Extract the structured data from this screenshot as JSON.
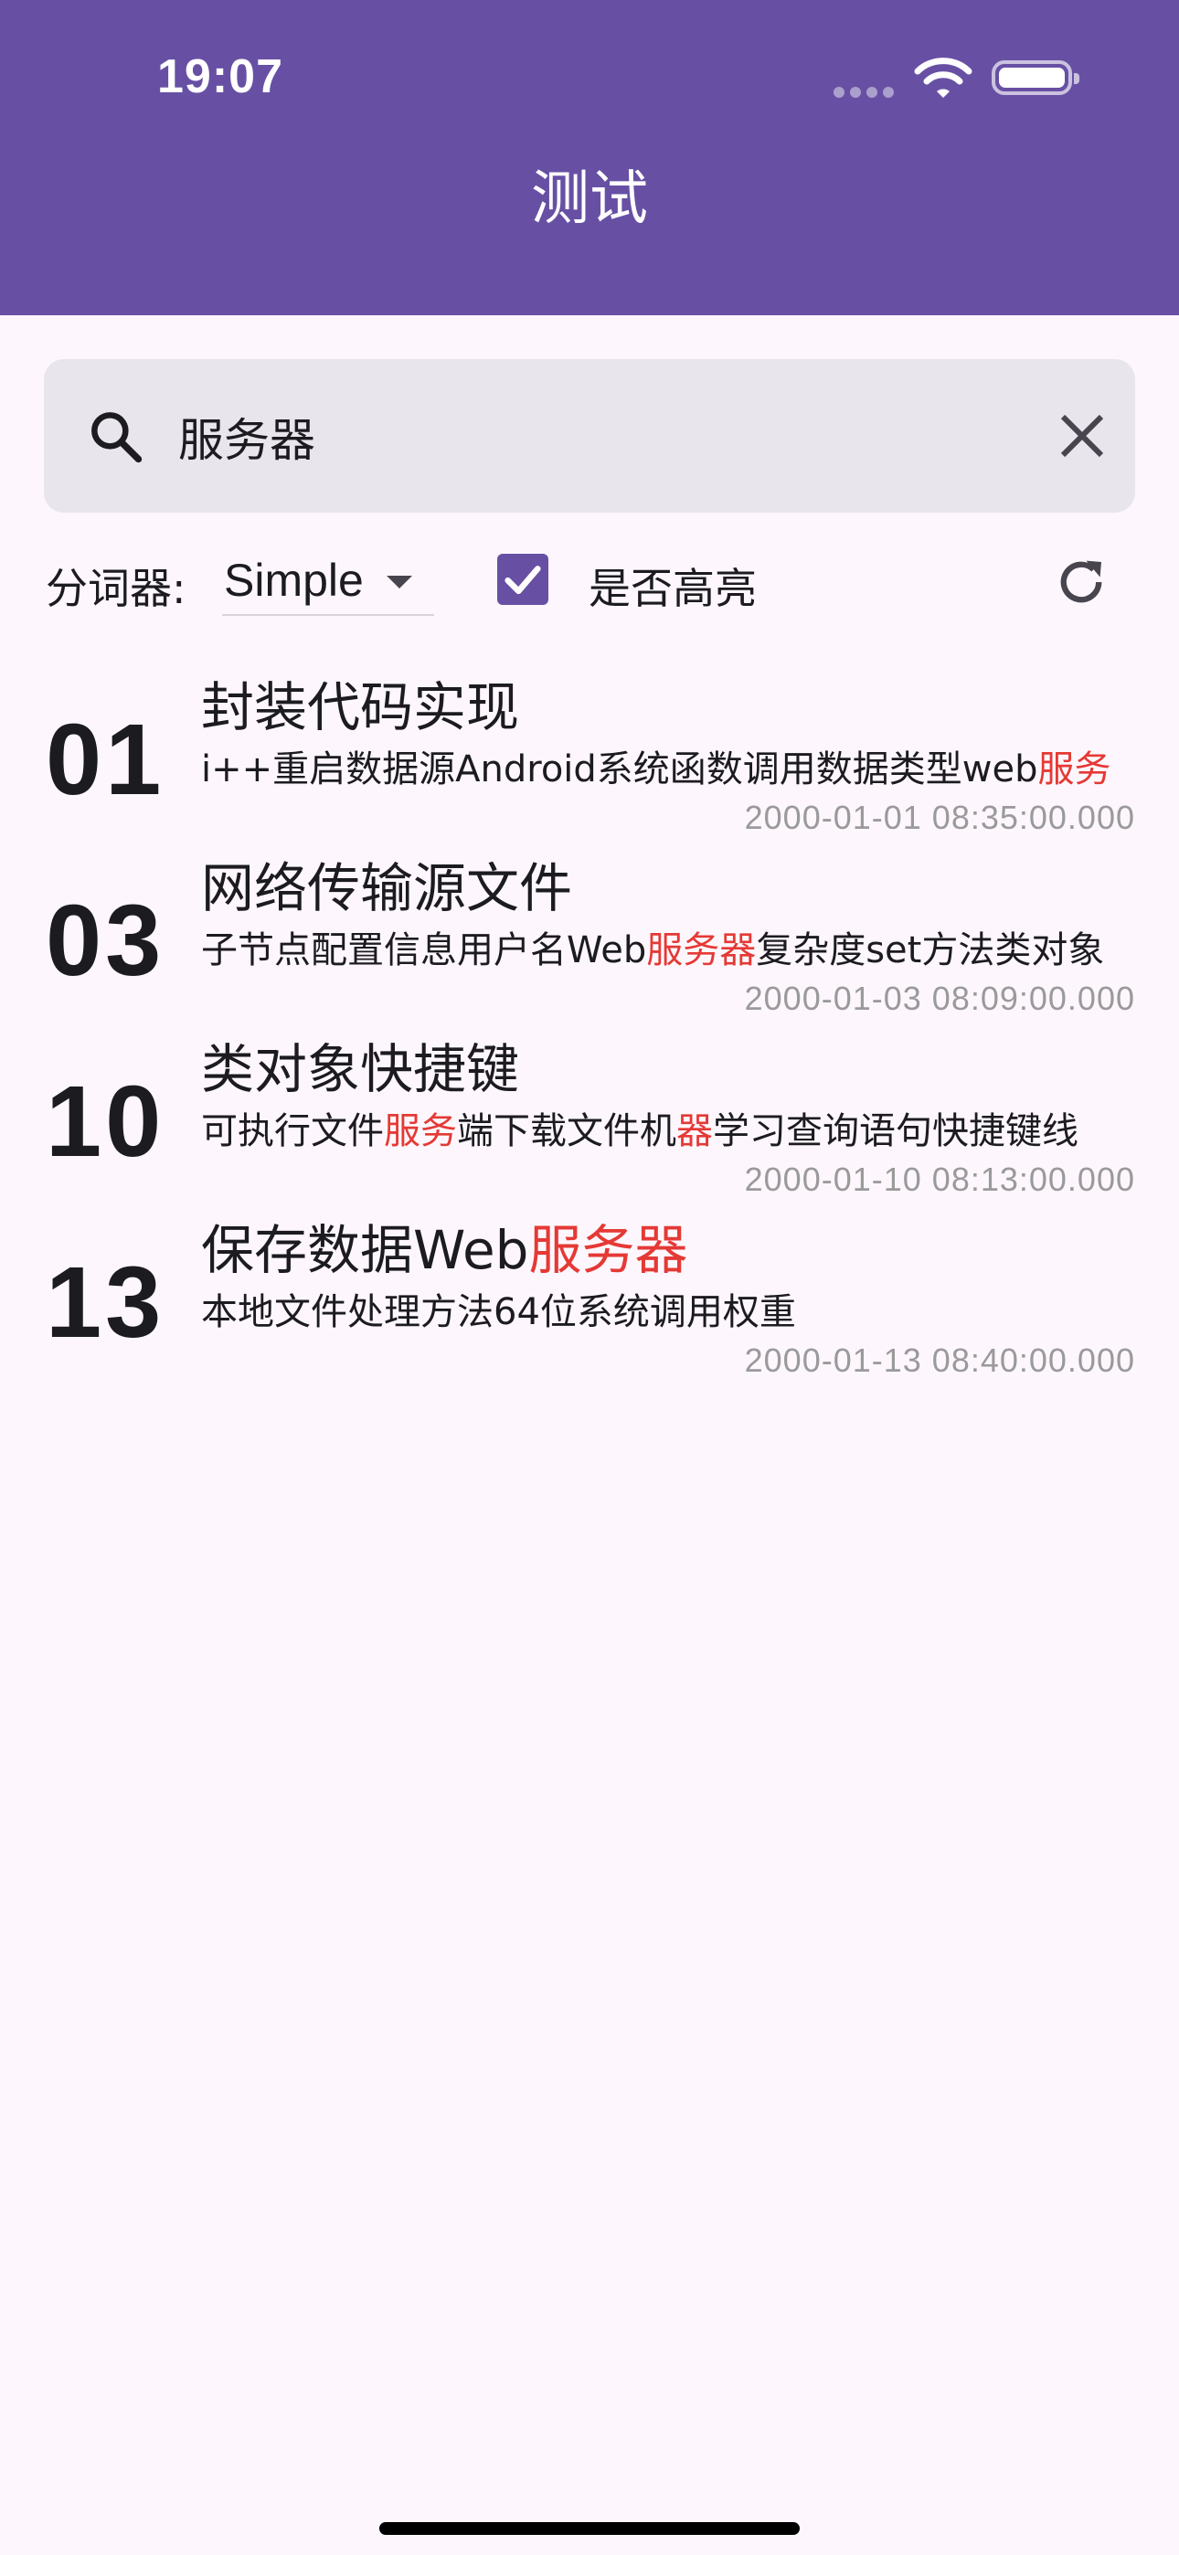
{
  "status_bar": {
    "time": "19:07"
  },
  "app_bar": {
    "title": "测试"
  },
  "search": {
    "value": "服务器"
  },
  "toolbar": {
    "segmenter_label": "分词器:",
    "segmenter_value": "Simple",
    "highlight_label": "是否高亮",
    "highlight_checked": true
  },
  "colors": {
    "primary": "#6750a4",
    "highlight": "#e53935",
    "search_bg": "#e8e5ec",
    "page_bg": "#fdf7fd"
  },
  "results": [
    {
      "number": "01",
      "title": [
        {
          "t": "封装代码实现"
        }
      ],
      "body": [
        {
          "t": "i++重启数据源Android系统函数调用数据类型web"
        },
        {
          "t": "服务",
          "hl": true
        }
      ],
      "time": "2000-01-01 08:35:00.000"
    },
    {
      "number": "03",
      "title": [
        {
          "t": "网络传输源文件"
        }
      ],
      "body": [
        {
          "t": "子节点配置信息用户名Web"
        },
        {
          "t": "服务器",
          "hl": true
        },
        {
          "t": "复杂度set方法类对象"
        }
      ],
      "time": "2000-01-03 08:09:00.000"
    },
    {
      "number": "10",
      "title": [
        {
          "t": "类对象快捷键"
        }
      ],
      "body": [
        {
          "t": "可执行文件"
        },
        {
          "t": "服务",
          "hl": true
        },
        {
          "t": "端下载文件机"
        },
        {
          "t": "器",
          "hl": true
        },
        {
          "t": "学习查询语句快捷键线"
        }
      ],
      "time": "2000-01-10 08:13:00.000"
    },
    {
      "number": "13",
      "title": [
        {
          "t": "保存数据Web"
        },
        {
          "t": "服务器",
          "hl": true
        }
      ],
      "body": [
        {
          "t": "本地文件处理方法64位系统调用权重"
        }
      ],
      "time": "2000-01-13 08:40:00.000"
    }
  ]
}
